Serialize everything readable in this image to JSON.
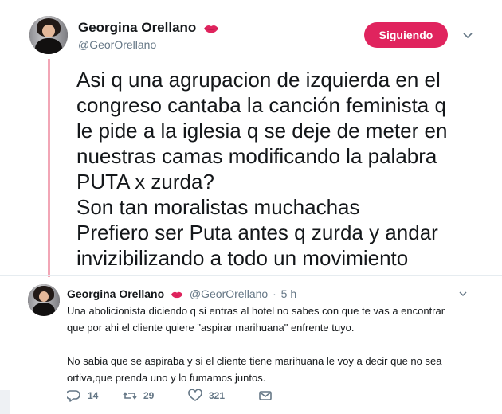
{
  "main_tweet": {
    "author_name": "Georgina Orellano",
    "author_handle": "@GeorOrellano",
    "follow_button": "Siguiendo",
    "lines": [
      "Asi q una agrupacion de izquierda en el",
      "congreso cantaba la canción feminista q",
      "le pide a la iglesia q se deje de meter en",
      "nuestras camas modificando la palabra",
      "PUTA x zurda?",
      "Son tan moralistas muchachas",
      "Prefiero ser Puta antes q zurda y andar",
      "invizibilizando a todo un movimiento"
    ],
    "accent_color": "#e0245e",
    "thread_color": "#f2a6b6"
  },
  "reply_tweet": {
    "author_name": "Georgina Orellano",
    "author_handle": "@GeorOrellano",
    "separator": "·",
    "time": "5 h",
    "paragraph1": [
      "Una abolicionista diciendo q si entras al hotel no sabes con que te vas a encontrar",
      "que por ahi el cliente quiere \"aspirar marihuana\" enfrente tuyo."
    ],
    "paragraph2": [
      "No sabia que se aspiraba y si el cliente tiene marihuana le voy a decir que no sea",
      "ortiva,que prenda uno y lo fumamos juntos."
    ],
    "replies": "14",
    "retweets": "29",
    "likes": "321",
    "icons": [
      "reply-icon",
      "retweet-icon",
      "like-icon",
      "direct-message-icon",
      "lips-emoji-icon",
      "chevron-down-icon"
    ]
  }
}
